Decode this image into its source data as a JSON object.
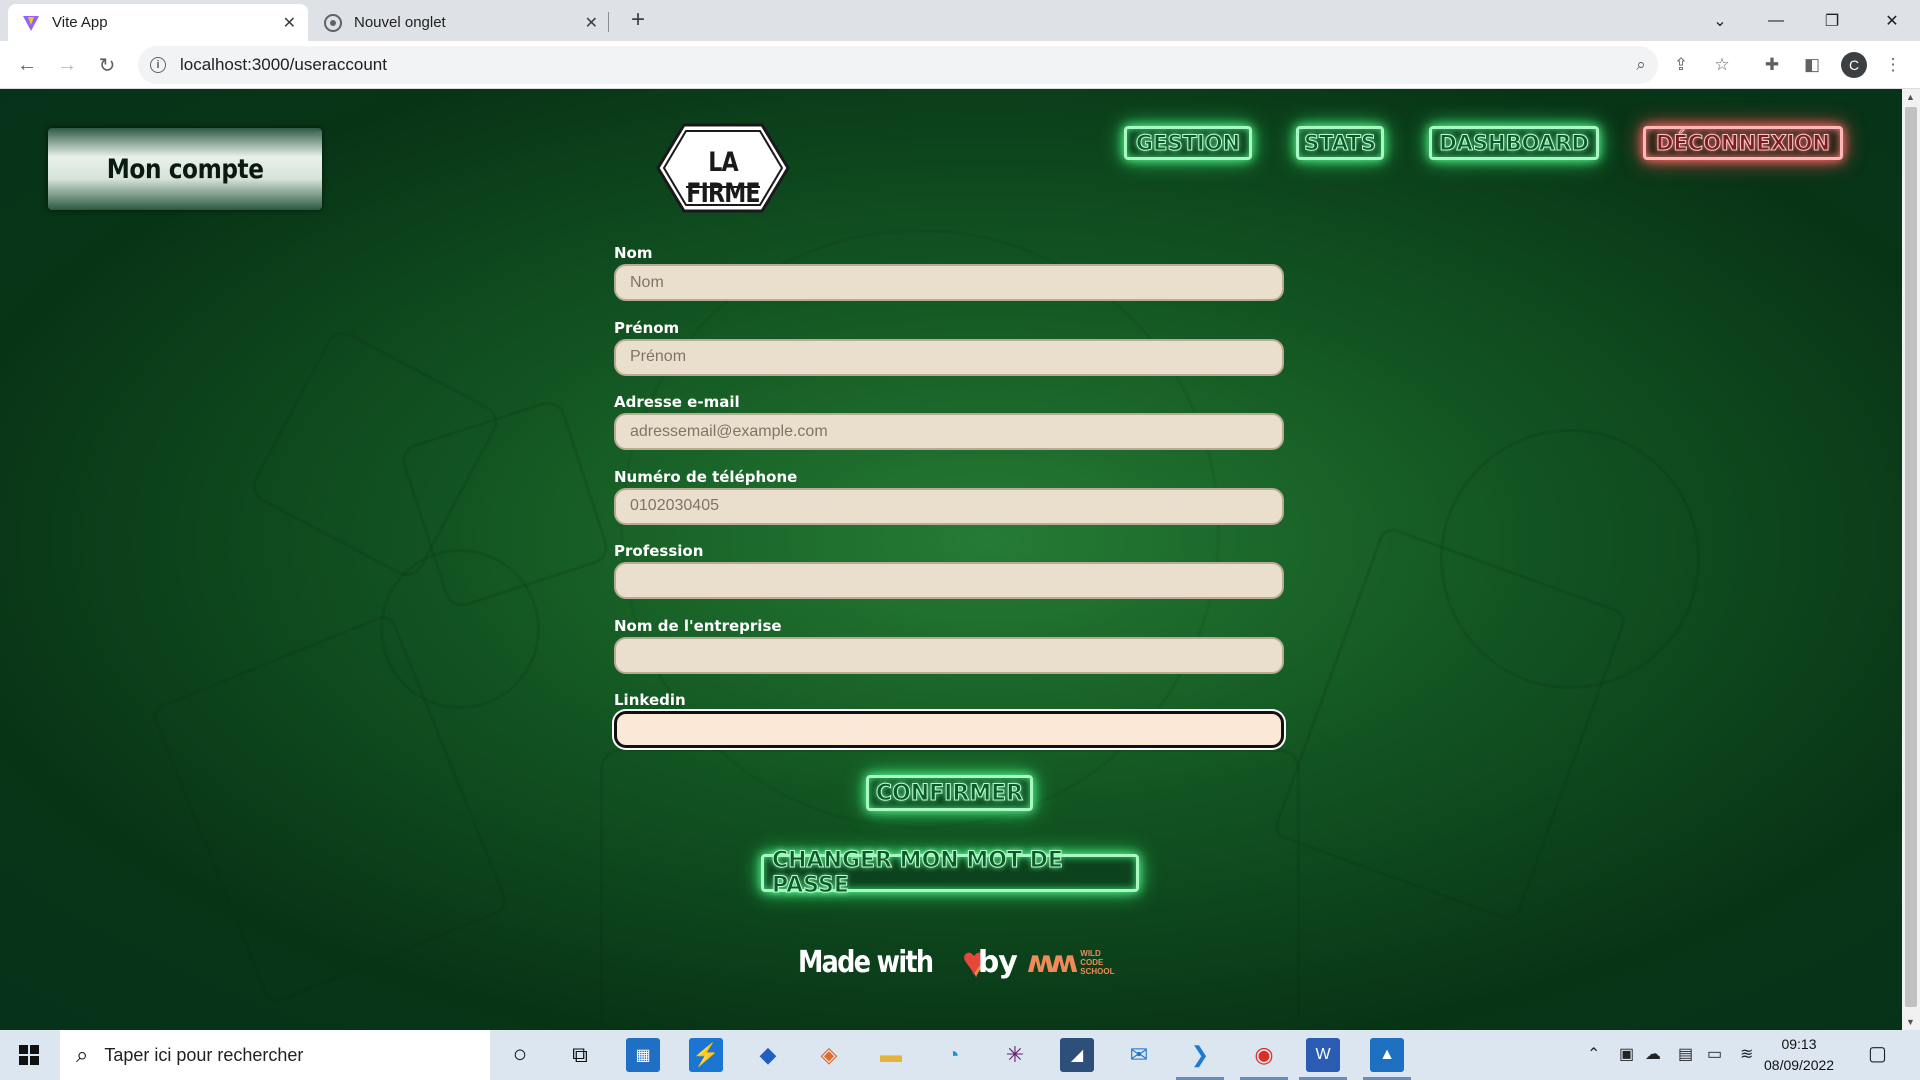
{
  "browser": {
    "tabs": [
      {
        "title": "Vite App",
        "active": true
      },
      {
        "title": "Nouvel onglet",
        "active": false
      }
    ],
    "url": "localhost:3000/useraccount",
    "profile_initial": "C"
  },
  "page": {
    "account_button": "Mon compte",
    "logo_text": "LA FIRME",
    "nav": {
      "gestion": "GESTION",
      "stats": "STATS",
      "dashboard": "DASHBOARD",
      "logout": "DÉCONNEXION"
    },
    "form": {
      "fields": [
        {
          "label": "Nom",
          "placeholder": "Nom",
          "value": ""
        },
        {
          "label": "Prénom",
          "placeholder": "Prénom",
          "value": ""
        },
        {
          "label": "Adresse e-mail",
          "placeholder": "adressemail@example.com",
          "value": ""
        },
        {
          "label": "Numéro de téléphone",
          "placeholder": "0102030405",
          "value": ""
        },
        {
          "label": "Profession",
          "placeholder": "",
          "value": ""
        },
        {
          "label": "Nom de l'entreprise",
          "placeholder": "",
          "value": ""
        },
        {
          "label": "Linkedin",
          "placeholder": "",
          "value": "",
          "focused": true
        }
      ],
      "confirm_label": "CONFIRMER",
      "change_password_label": "CHANGER MON MOT DE PASSE"
    },
    "footer": {
      "made_with": "Made with",
      "by": "by",
      "brand": "WILD CODE SCHOOL"
    }
  },
  "taskbar": {
    "search_placeholder": "Taper ici pour rechercher",
    "time": "09:13",
    "date": "08/09/2022"
  },
  "colors": {
    "neon_green": "#a9f7c2",
    "neon_red": "#ffb7b7",
    "input_bg": "#eadfcc",
    "page_bg": "#0b3a1a"
  }
}
